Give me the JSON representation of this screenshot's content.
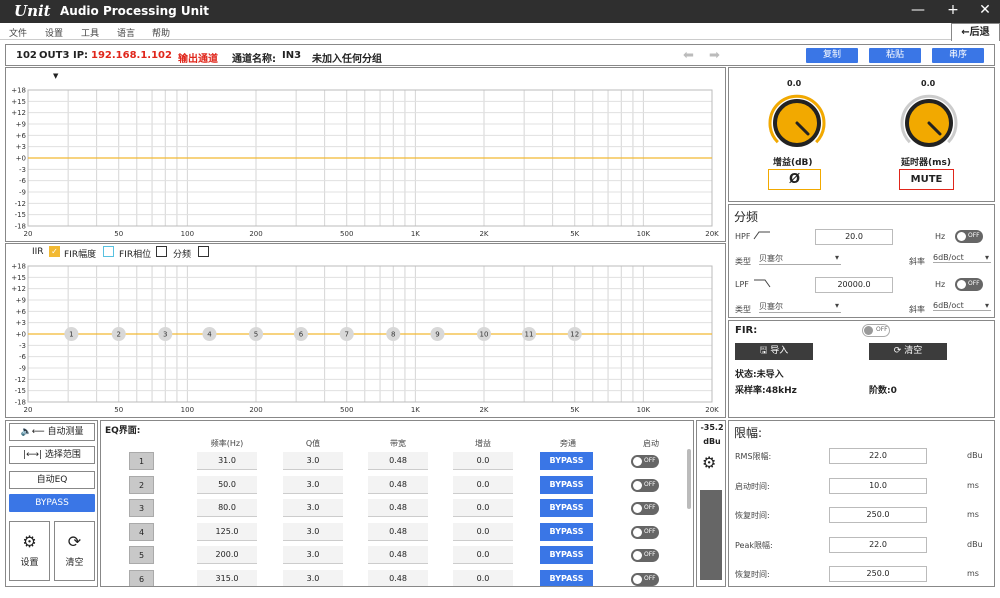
{
  "titlebar": {
    "logo": "Unit",
    "title": "Audio Processing Unit",
    "minimize": "—",
    "maximize": "+",
    "close": "✕"
  },
  "menu": [
    "文件",
    "设置",
    "工具",
    "语言",
    "帮助"
  ],
  "back_tab": "←后退",
  "info": {
    "device": "102",
    "output": "OUT3",
    "ip_label": "IP:",
    "ip": "192.168.1.102",
    "channel_type": "输出通道",
    "channel_name_label": "通道名称:",
    "channel_name": "IN3",
    "group": "未加入任何分组",
    "copy": "复制",
    "paste": "粘贴",
    "link": "串序"
  },
  "upper_plot": {
    "y_ticks": [
      "+18",
      "+15",
      "+12",
      "+9",
      "+6",
      "+3",
      "+0",
      "-3",
      "-6",
      "-9",
      "-12",
      "-15",
      "-18"
    ],
    "x_ticks": [
      "20",
      "50",
      "100",
      "200",
      "500",
      "1K",
      "2K",
      "5K",
      "10K",
      "20K"
    ]
  },
  "lower_plot": {
    "y_ticks": [
      "+18",
      "+15",
      "+12",
      "+9",
      "+6",
      "+3",
      "+0",
      "-3",
      "-6",
      "-9",
      "-12",
      "-15",
      "-18"
    ],
    "x_ticks": [
      "20",
      "50",
      "100",
      "200",
      "500",
      "1K",
      "2K",
      "5K",
      "10K",
      "20K"
    ],
    "markers": [
      "1",
      "2",
      "3",
      "4",
      "5",
      "6",
      "7",
      "8",
      "9",
      "10",
      "11",
      "12"
    ],
    "legend": {
      "iir": "IIR",
      "fir_amp": "FIR幅度",
      "fir_phase": "FIR相位",
      "crossover": "分频"
    }
  },
  "gain": {
    "value": "0.0",
    "label": "增益(dB)",
    "phase_btn": "Ø",
    "level": 0.75
  },
  "delay": {
    "value": "0.0",
    "label": "延时器(ms)",
    "mute_btn": "MUTE"
  },
  "crossover": {
    "title": "分频",
    "hpf_label": "HPF",
    "hpf_value": "20.0",
    "hz1": "Hz",
    "hpf_toggle": "OFF",
    "type_label1": "类型",
    "type_value1": "贝塞尔",
    "slope_label1": "斜率",
    "slope_value1": "6dB/oct",
    "lpf_label": "LPF",
    "lpf_value": "20000.0",
    "hz2": "Hz",
    "lpf_toggle": "OFF",
    "type_label2": "类型",
    "type_value2": "贝塞尔",
    "slope_label2": "斜率",
    "slope_value2": "6dB/oct"
  },
  "fir": {
    "title": "FIR:",
    "toggle": "OFF",
    "import_btn": "导入",
    "clear_btn": "清空",
    "status": "状态:未导入",
    "sample_rate": "采样率:48kHz",
    "taps": "阶数:0"
  },
  "side": {
    "auto_measure": "自动测量",
    "select_range": "选择范围",
    "auto_eq": "自动EQ",
    "bypass": "BYPASS",
    "settings": "设置",
    "clear": "清空"
  },
  "eq": {
    "title": "EQ界面:",
    "headers": [
      "频率(Hz)",
      "Q值",
      "带宽",
      "增益",
      "旁通",
      "启动"
    ],
    "rows": [
      {
        "n": "1",
        "freq": "31.0",
        "q": "3.0",
        "bw": "0.48",
        "gain": "0.0",
        "bypass": "BYPASS",
        "on": "OFF"
      },
      {
        "n": "2",
        "freq": "50.0",
        "q": "3.0",
        "bw": "0.48",
        "gain": "0.0",
        "bypass": "BYPASS",
        "on": "OFF"
      },
      {
        "n": "3",
        "freq": "80.0",
        "q": "3.0",
        "bw": "0.48",
        "gain": "0.0",
        "bypass": "BYPASS",
        "on": "OFF"
      },
      {
        "n": "4",
        "freq": "125.0",
        "q": "3.0",
        "bw": "0.48",
        "gain": "0.0",
        "bypass": "BYPASS",
        "on": "OFF"
      },
      {
        "n": "5",
        "freq": "200.0",
        "q": "3.0",
        "bw": "0.48",
        "gain": "0.0",
        "bypass": "BYPASS",
        "on": "OFF"
      },
      {
        "n": "6",
        "freq": "315.0",
        "q": "3.0",
        "bw": "0.48",
        "gain": "0.0",
        "bypass": "BYPASS",
        "on": "OFF"
      }
    ]
  },
  "meter": {
    "value": "-35.2",
    "unit": "dBu"
  },
  "limiter": {
    "title": "限幅:",
    "rows": [
      {
        "label": "RMS限幅:",
        "value": "22.0",
        "unit": "dBu"
      },
      {
        "label": "启动时间:",
        "value": "10.0",
        "unit": "ms"
      },
      {
        "label": "恢复时间:",
        "value": "250.0",
        "unit": "ms"
      },
      {
        "label": "Peak限幅:",
        "value": "22.0",
        "unit": "dBu"
      },
      {
        "label": "恢复时间:",
        "value": "250.0",
        "unit": "ms"
      }
    ]
  }
}
